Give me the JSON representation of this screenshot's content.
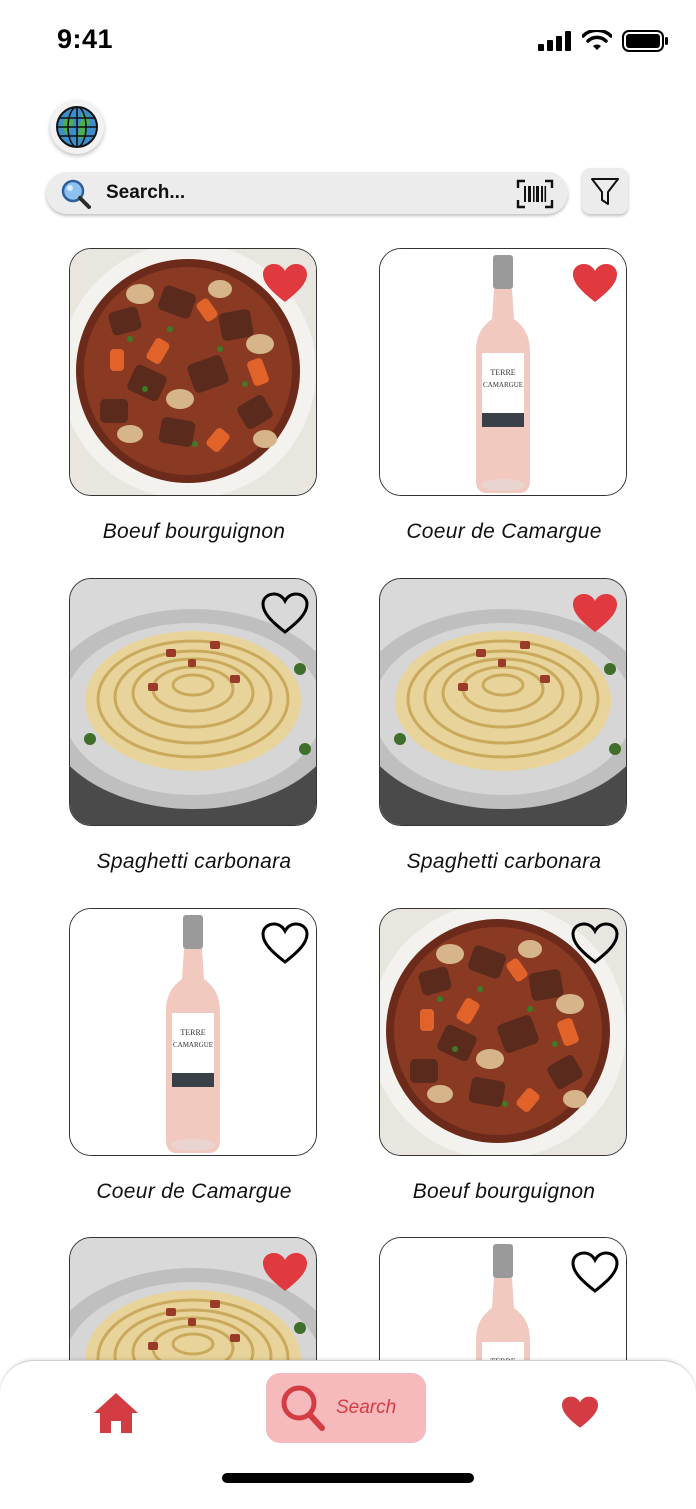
{
  "status_bar": {
    "time": "9:41"
  },
  "search": {
    "placeholder": "Search..."
  },
  "items": [
    {
      "name": "Boeuf bourguignon",
      "image": "beef-stew",
      "favorite": true
    },
    {
      "name": "Coeur de Camargue",
      "image": "rose-wine-bottle",
      "favorite": true
    },
    {
      "name": "Spaghetti carbonara",
      "image": "spaghetti",
      "favorite": false
    },
    {
      "name": "Spaghetti carbonara",
      "image": "spaghetti",
      "favorite": true
    },
    {
      "name": "Coeur de Camargue",
      "image": "rose-wine-bottle",
      "favorite": false
    },
    {
      "name": "Boeuf bourguignon",
      "image": "beef-stew",
      "favorite": false
    },
    {
      "name": "",
      "image": "spaghetti",
      "favorite": true
    },
    {
      "name": "",
      "image": "rose-wine-bottle",
      "favorite": false
    }
  ],
  "bottom_nav": {
    "home_icon": "home-icon",
    "search_label": "Search",
    "favorites_icon": "heart-icon"
  },
  "colors": {
    "accent": "#d43c43",
    "favorite": "#e0393f",
    "search_pill": "#f6b9bc"
  }
}
